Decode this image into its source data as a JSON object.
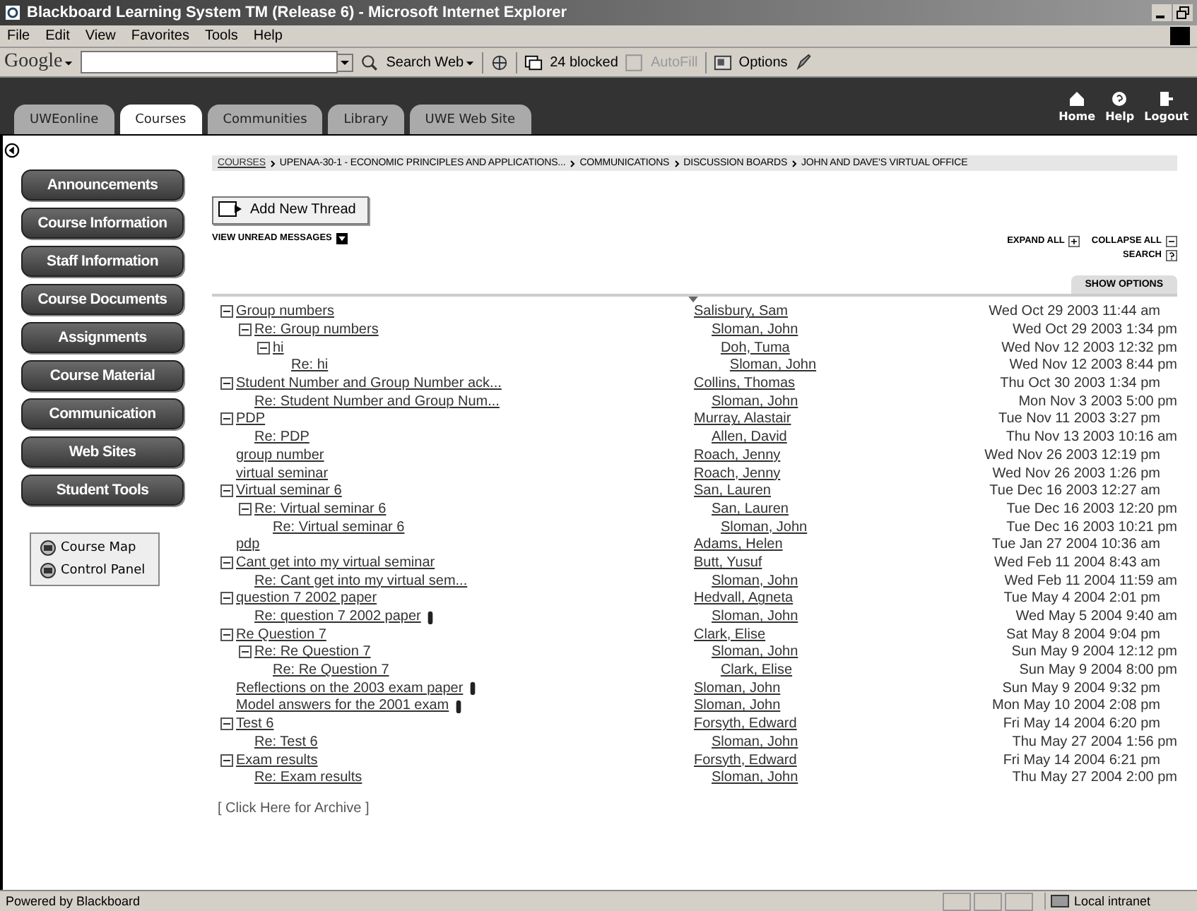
{
  "window": {
    "title": "Blackboard Learning System TM (Release 6) - Microsoft Internet Explorer"
  },
  "menu": [
    "File",
    "Edit",
    "View",
    "Favorites",
    "Tools",
    "Help"
  ],
  "toolbar": {
    "logo": "Google",
    "search_button": "Search Web",
    "blocked": "24 blocked",
    "autofill": "AutoFill",
    "autofill_disabled": true,
    "options": "Options"
  },
  "tabs": [
    {
      "label": "UWEonline",
      "selected": false
    },
    {
      "label": "Courses",
      "selected": true
    },
    {
      "label": "Communities",
      "selected": false
    },
    {
      "label": "Library",
      "selected": false
    },
    {
      "label": "UWE Web Site",
      "selected": false
    }
  ],
  "top_links": [
    "Home",
    "Help",
    "Logout"
  ],
  "sidebar": {
    "buttons": [
      "Announcements",
      "Course Information",
      "Staff Information",
      "Course Documents",
      "Assignments",
      "Course Material",
      "Communication",
      "Web Sites",
      "Student Tools"
    ],
    "tools": [
      "Course Map",
      "Control Panel"
    ]
  },
  "breadcrumb": [
    "COURSES",
    "UPENAA-30-1 - ECONOMIC PRINCIPLES AND APPLICATIONS...",
    "COMMUNICATIONS",
    "DISCUSSION BOARDS",
    "JOHN AND DAVE'S VIRTUAL OFFICE"
  ],
  "add_thread": "Add New Thread",
  "view_unread": "VIEW UNREAD MESSAGES",
  "expand_all": "EXPAND ALL",
  "collapse_all": "COLLAPSE ALL",
  "search": "SEARCH",
  "show_options": "SHOW OPTIONS",
  "threads": [
    {
      "subject": "Group numbers",
      "author": "Salisbury, Sam",
      "date": "Wed Oct 29 2003 11:44 am",
      "expanded": true,
      "children": [
        {
          "subject": "Re: Group numbers",
          "author": "Sloman, John",
          "date": "Wed Oct 29 2003 1:34 pm",
          "expanded": true,
          "children": [
            {
              "subject": "hi",
              "author": "Doh, Tuma",
              "date": "Wed Nov 12 2003 12:32 pm",
              "expanded": true,
              "children": [
                {
                  "subject": "Re: hi",
                  "author": "Sloman, John",
                  "date": "Wed Nov 12 2003 8:44 pm"
                }
              ]
            }
          ]
        }
      ]
    },
    {
      "subject": "Student Number and Group Number ack...",
      "author": "Collins, Thomas",
      "date": "Thu Oct 30 2003 1:34 pm",
      "expanded": true,
      "children": [
        {
          "subject": "Re: Student Number and Group Num...",
          "author": "Sloman, John",
          "date": "Mon Nov 3 2003 5:00 pm"
        }
      ]
    },
    {
      "subject": "PDP",
      "author": "Murray, Alastair",
      "date": "Tue Nov 11 2003 3:27 pm",
      "expanded": true,
      "children": [
        {
          "subject": "Re: PDP",
          "author": "Allen, David",
          "date": "Thu Nov 13 2003 10:16 am"
        }
      ]
    },
    {
      "subject": "group number",
      "author": "Roach, Jenny",
      "date": "Wed Nov 26 2003 12:19 pm"
    },
    {
      "subject": "virtual seminar",
      "author": "Roach, Jenny",
      "date": "Wed Nov 26 2003 1:26 pm"
    },
    {
      "subject": "Virtual seminar 6",
      "author": "San, Lauren",
      "date": "Tue Dec 16 2003 12:27 am",
      "expanded": true,
      "children": [
        {
          "subject": "Re: Virtual seminar 6",
          "author": "San, Lauren",
          "date": "Tue Dec 16 2003 12:20 pm",
          "expanded": true,
          "children": [
            {
              "subject": "Re: Virtual seminar 6",
              "author": "Sloman, John",
              "date": "Tue Dec 16 2003 10:21 pm"
            }
          ]
        }
      ]
    },
    {
      "subject": "pdp",
      "author": "Adams, Helen",
      "date": "Tue Jan 27 2004 10:36 am"
    },
    {
      "subject": "Cant get into my virtual seminar",
      "author": "Butt, Yusuf",
      "date": "Wed Feb 11 2004 8:43 am",
      "expanded": true,
      "children": [
        {
          "subject": "Re: Cant get into my virtual sem...",
          "author": "Sloman, John",
          "date": "Wed Feb 11 2004 11:59 am"
        }
      ]
    },
    {
      "subject": "question 7 2002 paper",
      "author": "Hedvall, Agneta",
      "date": "Tue May 4 2004 2:01 pm",
      "expanded": true,
      "children": [
        {
          "subject": "Re: question 7 2002 paper",
          "author": "Sloman, John",
          "date": "Wed May 5 2004 9:40 am",
          "attachment": true
        }
      ]
    },
    {
      "subject": "Re Question 7",
      "author": "Clark, Elise",
      "date": "Sat May 8 2004 9:04 pm",
      "expanded": true,
      "children": [
        {
          "subject": "Re: Re Question 7",
          "author": "Sloman, John",
          "date": "Sun May 9 2004 12:12 pm",
          "expanded": true,
          "children": [
            {
              "subject": "Re: Re Question 7",
              "author": "Clark, Elise",
              "date": "Sun May 9 2004 8:00 pm"
            }
          ]
        }
      ]
    },
    {
      "subject": "Reflections on the 2003 exam paper",
      "author": "Sloman, John",
      "date": "Sun May 9 2004 9:32 pm",
      "attachment": true
    },
    {
      "subject": "Model answers for the 2001 exam",
      "author": "Sloman, John",
      "date": "Mon May 10 2004 2:08 pm",
      "attachment": true
    },
    {
      "subject": "Test 6",
      "author": "Forsyth, Edward",
      "date": "Fri May 14 2004 6:20 pm",
      "expanded": true,
      "children": [
        {
          "subject": "Re: Test 6",
          "author": "Sloman, John",
          "date": "Thu May 27 2004 1:56 pm"
        }
      ]
    },
    {
      "subject": "Exam results",
      "author": "Forsyth, Edward",
      "date": "Fri May 14 2004 6:21 pm",
      "expanded": true,
      "children": [
        {
          "subject": "Re: Exam results",
          "author": "Sloman, John",
          "date": "Thu May 27 2004 2:00 pm"
        }
      ]
    }
  ],
  "archive_link": "[ Click Here for Archive ]",
  "status_bar": {
    "left": "Powered by Blackboard",
    "zone": "Local intranet"
  }
}
